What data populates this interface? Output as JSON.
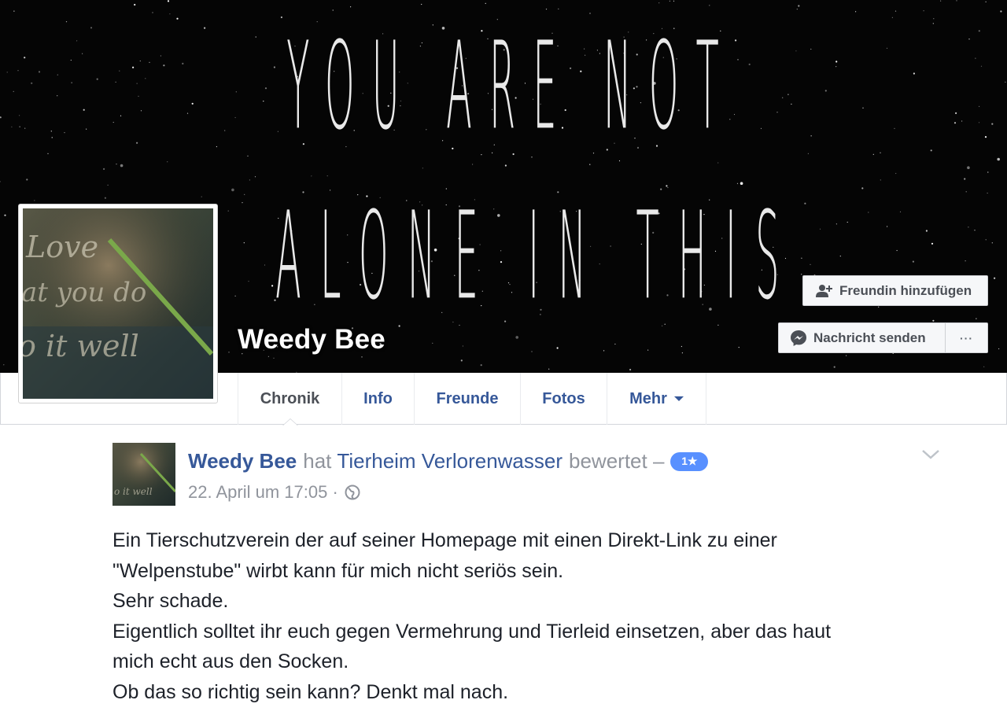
{
  "cover": {
    "line1": "YOU ARE NOT",
    "line2": "ALONE IN THIS"
  },
  "profile": {
    "name": "Weedy Bee",
    "avatar_icon": "profile-photo",
    "avatar_text": [
      "Love",
      "at you do",
      "o it well"
    ]
  },
  "actions": {
    "add_friend": "Freundin hinzufügen",
    "send_message": "Nachricht senden",
    "more": "···"
  },
  "tabs": [
    {
      "label": "Chronik",
      "active": true
    },
    {
      "label": "Info"
    },
    {
      "label": "Freunde"
    },
    {
      "label": "Fotos"
    },
    {
      "label": "Mehr"
    }
  ],
  "post": {
    "author": "Weedy Bee",
    "verb_rated": "hat",
    "page": "Tierheim Verlorenwasser",
    "verb_suffix": "bewertet –",
    "rating": "1★",
    "date": "22. April um 17:05 ·",
    "privacy_icon": "globe-icon",
    "menu_icon": "chevron-down-icon",
    "lines": [
      "Ein Tierschutzverein der auf seiner Homepage mit einen Direkt-Link zu einer",
      "\"Welpenstube\" wirbt kann für mich nicht seriös sein.",
      "Sehr schade.",
      "Eigentlich solltet ihr euch gegen Vermehrung und Tierleid einsetzen, aber das haut",
      "mich echt aus den Socken.",
      "Ob das so richtig sein kann? Denkt mal nach."
    ]
  },
  "colors": {
    "link_blue": "#365899",
    "meta_gray": "#90949c",
    "badge_blue": "#5890ff",
    "cover_bg": "#050505"
  }
}
